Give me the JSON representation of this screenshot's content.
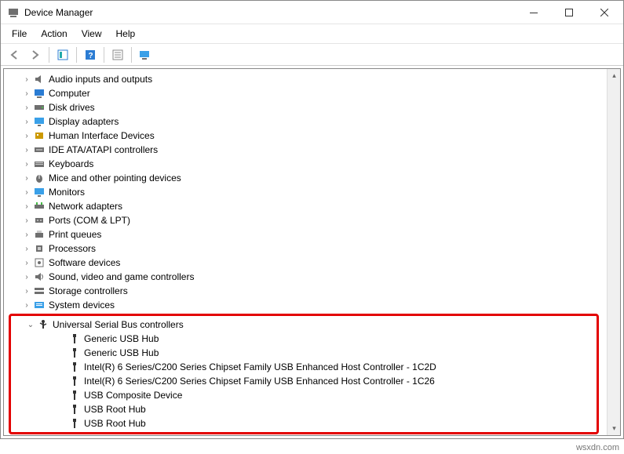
{
  "window": {
    "title": "Device Manager"
  },
  "menu": {
    "file": "File",
    "action": "Action",
    "view": "View",
    "help": "Help"
  },
  "categories": [
    {
      "label": "Audio inputs and outputs",
      "icon": "audio"
    },
    {
      "label": "Computer",
      "icon": "computer"
    },
    {
      "label": "Disk drives",
      "icon": "disk"
    },
    {
      "label": "Display adapters",
      "icon": "display"
    },
    {
      "label": "Human Interface Devices",
      "icon": "hid"
    },
    {
      "label": "IDE ATA/ATAPI controllers",
      "icon": "ide"
    },
    {
      "label": "Keyboards",
      "icon": "keyboard"
    },
    {
      "label": "Mice and other pointing devices",
      "icon": "mouse"
    },
    {
      "label": "Monitors",
      "icon": "monitor"
    },
    {
      "label": "Network adapters",
      "icon": "network"
    },
    {
      "label": "Ports (COM & LPT)",
      "icon": "port"
    },
    {
      "label": "Print queues",
      "icon": "printer"
    },
    {
      "label": "Processors",
      "icon": "cpu"
    },
    {
      "label": "Software devices",
      "icon": "software"
    },
    {
      "label": "Sound, video and game controllers",
      "icon": "sound"
    },
    {
      "label": "Storage controllers",
      "icon": "storage"
    },
    {
      "label": "System devices",
      "icon": "system"
    }
  ],
  "usb": {
    "label": "Universal Serial Bus controllers",
    "children": [
      "Generic USB Hub",
      "Generic USB Hub",
      "Intel(R) 6 Series/C200 Series Chipset Family USB Enhanced Host Controller - 1C2D",
      "Intel(R) 6 Series/C200 Series Chipset Family USB Enhanced Host Controller - 1C26",
      "USB Composite Device",
      "USB Root Hub",
      "USB Root Hub"
    ]
  },
  "watermark": "wsxdn.com"
}
